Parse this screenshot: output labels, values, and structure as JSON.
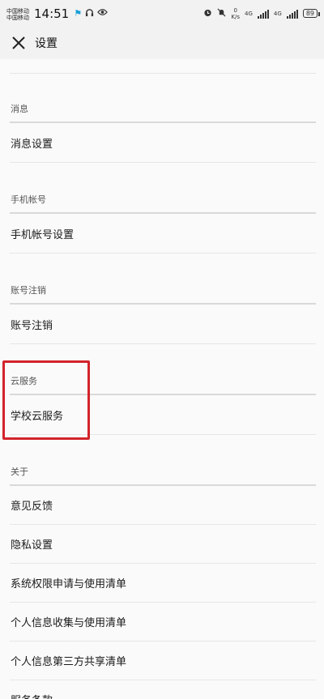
{
  "status_bar": {
    "carrier_1": "中国移动",
    "carrier_2": "中国移动",
    "time": "14:51",
    "net_speed_value": "0",
    "net_speed_unit": "K/s",
    "network_1": "4G",
    "network_2": "4G",
    "battery": "89"
  },
  "header": {
    "title": "设置"
  },
  "sections": {
    "messages": {
      "title": "消息",
      "item": "消息设置"
    },
    "phone": {
      "title": "手机帐号",
      "item": "手机帐号设置"
    },
    "cancel": {
      "title": "账号注销",
      "item": "账号注销"
    },
    "cloud": {
      "title": "云服务",
      "item": "学校云服务"
    },
    "about": {
      "title": "关于",
      "items": [
        "意见反馈",
        "隐私设置",
        "系统权限申请与使用清单",
        "个人信息收集与使用清单",
        "个人信息第三方共享清单",
        "服务条款"
      ]
    }
  },
  "highlight_color": "#d2232a"
}
